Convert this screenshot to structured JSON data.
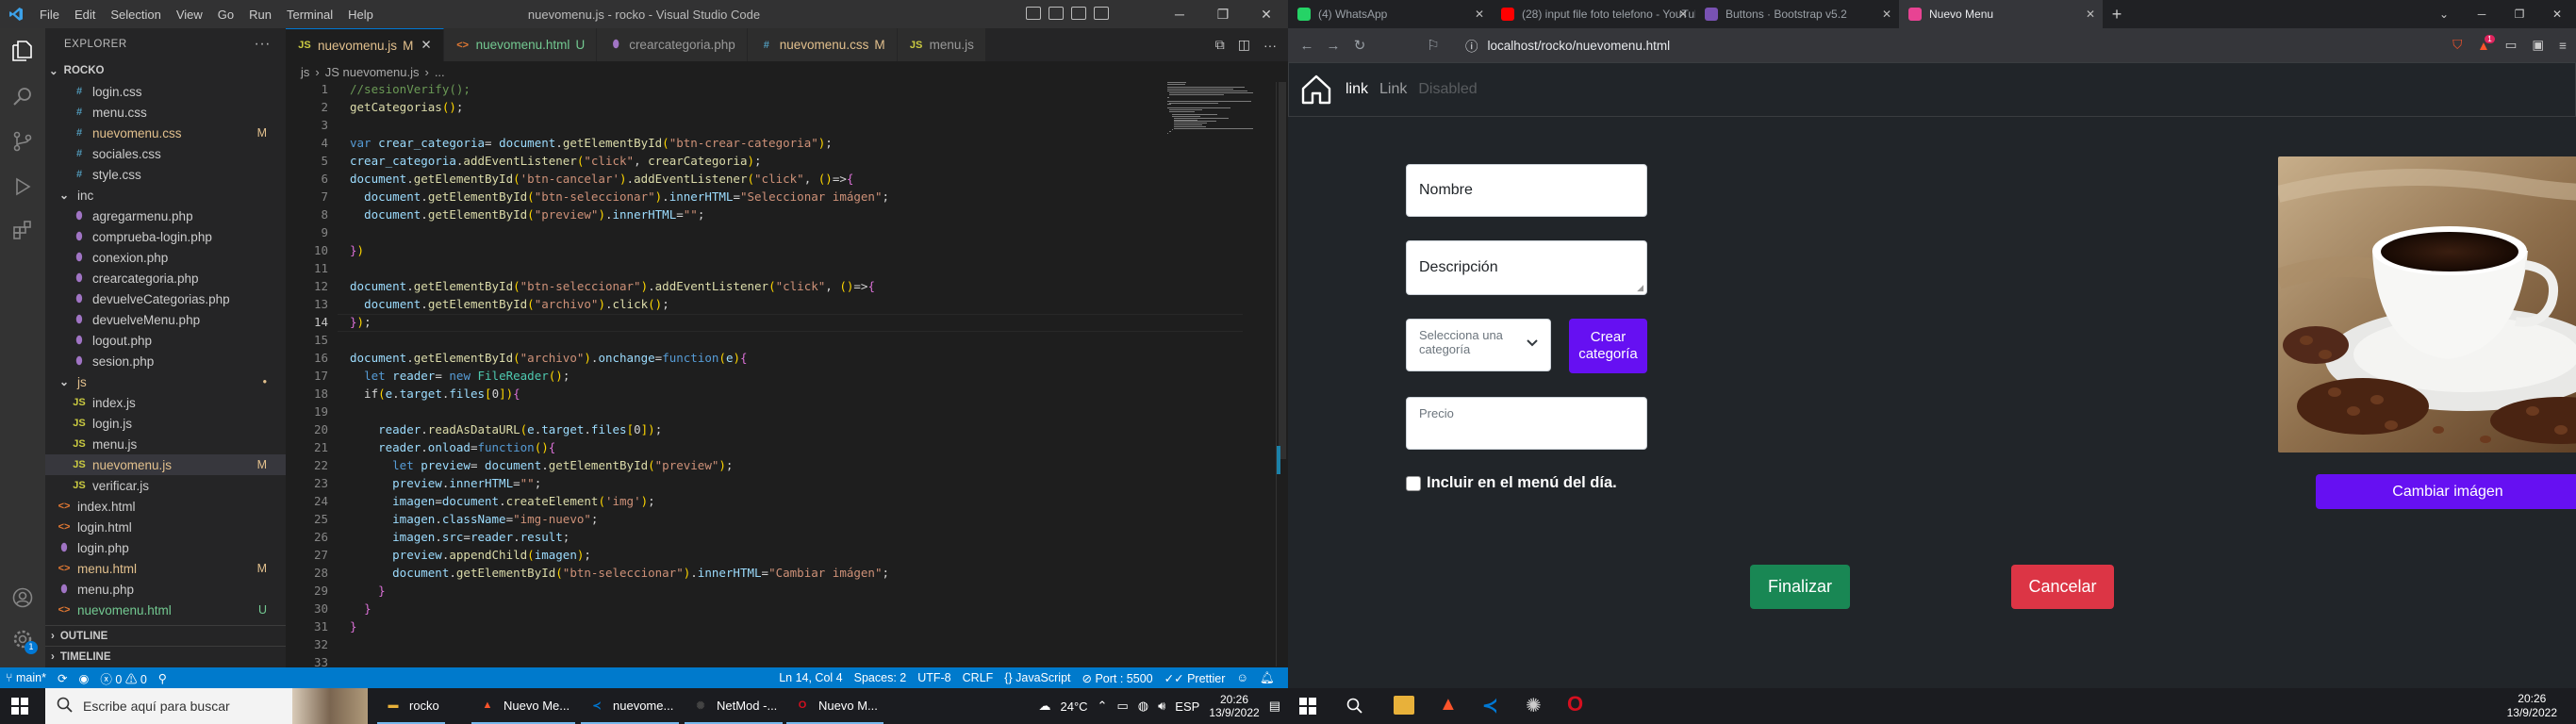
{
  "vscode": {
    "title": "nuevomenu.js - rocko - Visual Studio Code",
    "menu": [
      "File",
      "Edit",
      "Selection",
      "View",
      "Go",
      "Run",
      "Terminal",
      "Help"
    ],
    "explorer_title": "EXPLORER",
    "root": "ROCKO",
    "tree": [
      {
        "name": "login.css",
        "icon": "#",
        "type": "css",
        "depth": 1
      },
      {
        "name": "menu.css",
        "icon": "#",
        "type": "css",
        "depth": 1
      },
      {
        "name": "nuevomenu.css",
        "icon": "#",
        "type": "css",
        "depth": 1,
        "badge": "M",
        "color": "mod"
      },
      {
        "name": "sociales.css",
        "icon": "#",
        "type": "css",
        "depth": 1
      },
      {
        "name": "style.css",
        "icon": "#",
        "type": "css",
        "depth": 1
      },
      {
        "name": "inc",
        "icon": "⌄",
        "type": "fold",
        "depth": 0
      },
      {
        "name": "agregarmenu.php",
        "icon": "⬮",
        "type": "php",
        "depth": 1
      },
      {
        "name": "comprueba-login.php",
        "icon": "⬮",
        "type": "php",
        "depth": 1
      },
      {
        "name": "conexion.php",
        "icon": "⬮",
        "type": "php",
        "depth": 1
      },
      {
        "name": "crearcategoria.php",
        "icon": "⬮",
        "type": "php",
        "depth": 1
      },
      {
        "name": "devuelveCategorias.php",
        "icon": "⬮",
        "type": "php",
        "depth": 1
      },
      {
        "name": "devuelveMenu.php",
        "icon": "⬮",
        "type": "php",
        "depth": 1
      },
      {
        "name": "logout.php",
        "icon": "⬮",
        "type": "php",
        "depth": 1
      },
      {
        "name": "sesion.php",
        "icon": "⬮",
        "type": "php",
        "depth": 1
      },
      {
        "name": "js",
        "icon": "⌄",
        "type": "fold",
        "depth": 0,
        "badge": "•",
        "color": "mod"
      },
      {
        "name": "index.js",
        "icon": "JS",
        "type": "js",
        "depth": 1
      },
      {
        "name": "login.js",
        "icon": "JS",
        "type": "js",
        "depth": 1
      },
      {
        "name": "menu.js",
        "icon": "JS",
        "type": "js",
        "depth": 1
      },
      {
        "name": "nuevomenu.js",
        "icon": "JS",
        "type": "js",
        "depth": 1,
        "badge": "M",
        "color": "mod",
        "selected": true
      },
      {
        "name": "verificar.js",
        "icon": "JS",
        "type": "js",
        "depth": 1
      },
      {
        "name": "index.html",
        "icon": "<>",
        "type": "html",
        "depth": 0
      },
      {
        "name": "login.html",
        "icon": "<>",
        "type": "html",
        "depth": 0
      },
      {
        "name": "login.php",
        "icon": "⬮",
        "type": "php",
        "depth": 0
      },
      {
        "name": "menu.html",
        "icon": "<>",
        "type": "html",
        "depth": 0,
        "badge": "M",
        "color": "mod"
      },
      {
        "name": "menu.php",
        "icon": "⬮",
        "type": "php",
        "depth": 0
      },
      {
        "name": "nuevomenu.html",
        "icon": "<>",
        "type": "html",
        "depth": 0,
        "badge": "U",
        "color": "unt"
      }
    ],
    "outline": "OUTLINE",
    "timeline": "TIMELINE",
    "tabs": [
      {
        "label": "nuevomenu.js",
        "icon": "JS",
        "type": "js",
        "suffix": "M",
        "active": true
      },
      {
        "label": "nuevomenu.html",
        "icon": "<>",
        "type": "html",
        "suffix": "U"
      },
      {
        "label": "crearcategoria.php",
        "icon": "⬮",
        "type": "php",
        "suffix": ""
      },
      {
        "label": "nuevomenu.css",
        "icon": "#",
        "type": "css",
        "suffix": "M"
      },
      {
        "label": "menu.js",
        "icon": "JS",
        "type": "js",
        "suffix": ""
      }
    ],
    "breadcrumb": [
      "js",
      "JS nuevomenu.js",
      "..."
    ],
    "code": [
      "//sesionVerify();",
      "getCategorias();",
      "",
      "var crear_categoria= document.getElementById(\"btn-crear-categoria\");",
      "crear_categoria.addEventListener(\"click\", crearCategoria);",
      "document.getElementById('btn-cancelar').addEventListener(\"click\", ()=>{",
      "  document.getElementById(\"btn-seleccionar\").innerHTML=\"Seleccionar imágen\";",
      "  document.getElementById(\"preview\").innerHTML=\"\";",
      "",
      "})",
      "",
      "document.getElementById(\"btn-seleccionar\").addEventListener(\"click\", ()=>{",
      "  document.getElementById(\"archivo\").click();",
      "});",
      "",
      "document.getElementById(\"archivo\").onchange=function(e){",
      "  let reader= new FileReader();",
      "  if(e.target.files[0]){",
      "",
      "    reader.readAsDataURL(e.target.files[0]);",
      "    reader.onload=function(){",
      "      let preview= document.getElementById(\"preview\");",
      "      preview.innerHTML=\"\";",
      "      imagen=document.createElement('img');",
      "      imagen.className=\"img-nuevo\";",
      "      imagen.src=reader.result;",
      "      preview.appendChild(imagen);",
      "      document.getElementById(\"btn-seleccionar\").innerHTML=\"Cambiar imágen\";",
      "    }",
      "  }",
      "}",
      "",
      ""
    ],
    "current_line": 14,
    "status": {
      "branch": "main*",
      "errors": "0",
      "warnings": "0",
      "position": "Ln 14, Col 4",
      "spaces": "Spaces: 2",
      "encoding": "UTF-8",
      "eol": "CRLF",
      "language": "JavaScript",
      "port": "Port : 5500",
      "prettier": "Prettier"
    },
    "accounts_badge": "1"
  },
  "taskbar_left": {
    "search_placeholder": "Escribe aquí para buscar",
    "apps": [
      {
        "label": "rocko",
        "color": "#e8b13a",
        "glyph": "▬"
      },
      {
        "label": "Nuevo Me...",
        "color": "#fb542b",
        "glyph": "▲"
      },
      {
        "label": "nuevome...",
        "color": "#0078d4",
        "glyph": "≺"
      },
      {
        "label": "NetMod -...",
        "color": "#444",
        "glyph": "✺"
      },
      {
        "label": "Nuevo M...",
        "color": "#d50f1f",
        "glyph": "O"
      }
    ],
    "weather": "24°C",
    "lang": "ESP",
    "time": "20:26",
    "date": "13/9/2022"
  },
  "browser": {
    "tabs": [
      {
        "label": "(4) WhatsApp",
        "color": "#25d366"
      },
      {
        "label": "(28) input file foto telefono - YouTube",
        "color": "#ff0000"
      },
      {
        "label": "Buttons · Bootstrap v5.2",
        "color": "#7952b3"
      },
      {
        "label": "Nuevo Menu",
        "color": "#e84393",
        "active": true
      }
    ],
    "url": "localhost/rocko/nuevomenu.html",
    "shield_badge": "1"
  },
  "page": {
    "nav": [
      {
        "label": "link",
        "color": "#ffffff"
      },
      {
        "label": "Link",
        "color": "rgba(255,255,255,0.55)"
      },
      {
        "label": "Disabled",
        "color": "rgba(255,255,255,0.25)"
      }
    ],
    "nombre_placeholder": "Nombre",
    "descripcion_placeholder": "Descripción",
    "categoria_placeholder": "Selecciona una categoría",
    "crear_categoria_label": "Crear categoría",
    "precio_placeholder": "Precio",
    "checkbox_label": "Incluir en el menú del día.",
    "cambiar_imagen_label": "Cambiar imágen",
    "finalizar_label": "Finalizar",
    "cancelar_label": "Cancelar",
    "colors": {
      "primary": "#6610f2",
      "success": "#198754",
      "danger": "#dc3545"
    }
  },
  "taskbar_right": {
    "time": "20:26",
    "date": "13/9/2022"
  }
}
